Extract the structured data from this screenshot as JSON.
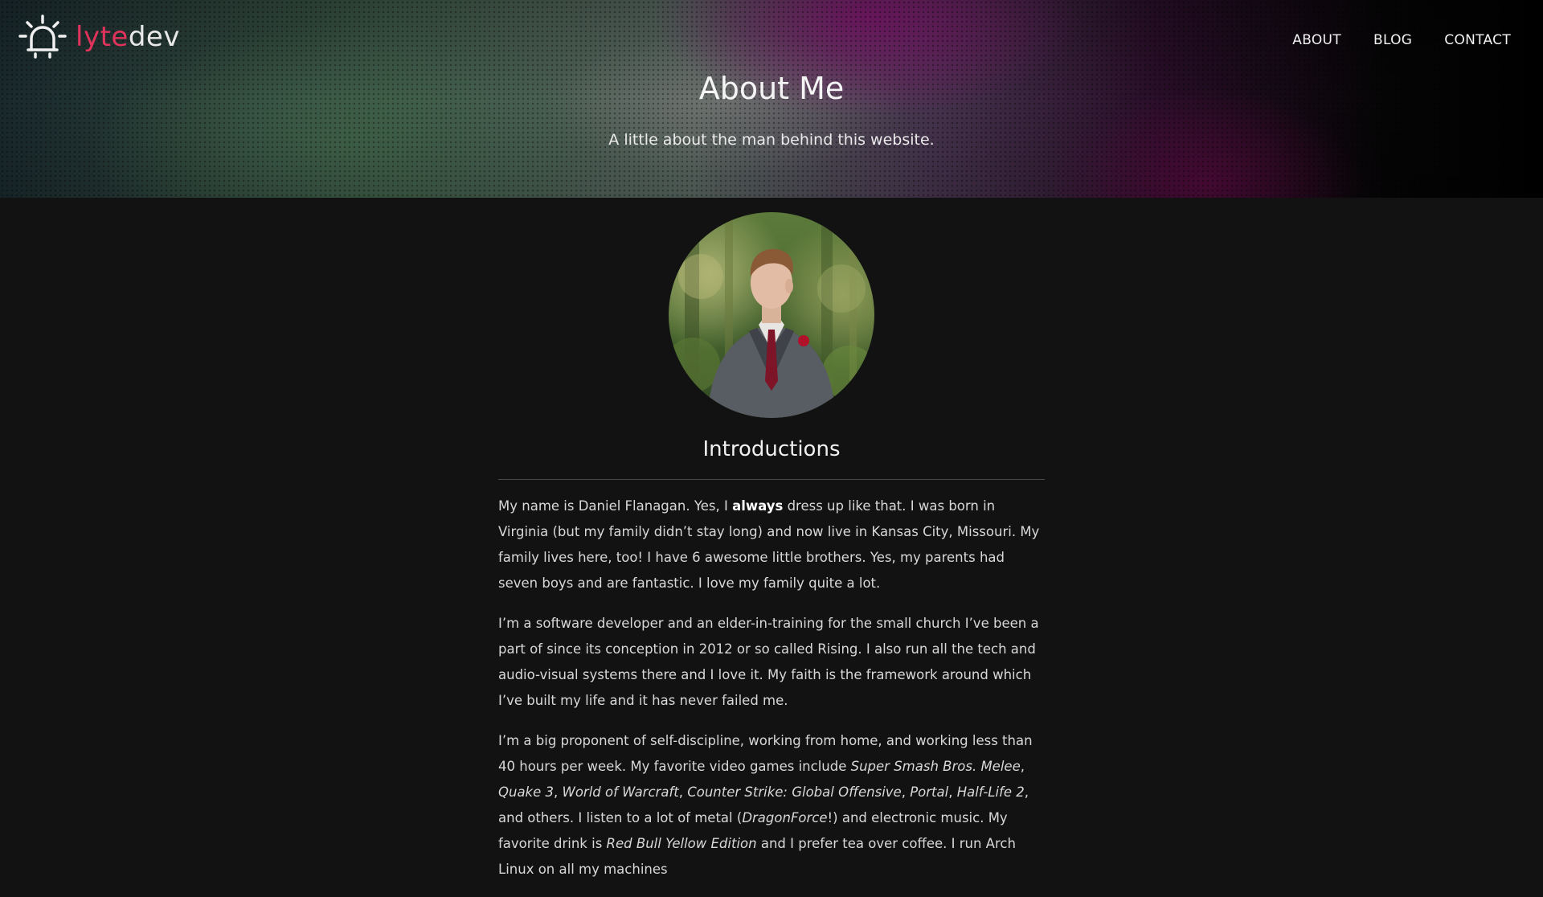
{
  "brand": {
    "logo_part1": "lyte",
    "logo_part2": "dev",
    "accent_color": "#e0335c"
  },
  "nav": {
    "items": [
      {
        "label": "ABOUT"
      },
      {
        "label": "BLOG"
      },
      {
        "label": "CONTACT"
      }
    ]
  },
  "hero": {
    "title": "About Me",
    "subtitle": "A little about the man behind this website."
  },
  "profile": {
    "avatar_icon": "portrait-photo"
  },
  "section": {
    "title": "Introductions",
    "paragraphs": [
      {
        "p1_a": "My name is Daniel Flanagan. Yes, I ",
        "p1_b": "always",
        "p1_c": " dress up like that. I was born in Virginia (but my family didn’t stay long) and now live in Kansas City, Missouri. My family lives here, too! I have 6 awesome little brothers. Yes, my parents had seven boys and are fantastic. I love my family quite a lot."
      },
      {
        "text": "I’m a software developer and an elder-in-training for the small church I’ve been a part of since its conception in 2012 or so called Rising. I also run all the tech and audio-visual systems there and I love it. My faith is the framework around which I’ve built my life and it has never failed me."
      },
      {
        "a": "I’m a big proponent of self-discipline, working from home, and working less than 40 hours per week. My favorite video games include ",
        "b": "Super Smash Bros. Melee",
        "c": ", ",
        "d": "Quake 3",
        "e": ", ",
        "f": "World of Warcraft",
        "g": ", ",
        "h": "Counter Strike: Global Offensive",
        "i": ", ",
        "j": "Portal",
        "k": ", ",
        "l": "Half-Life 2",
        "m": ", and others. I listen to a lot of metal (",
        "n": "DragonForce",
        "o": "!) and electronic music. My favorite drink is ",
        "p": "Red Bull Yellow Edition",
        "q": " and I prefer tea over coffee. I run Arch Linux on all my machines"
      }
    ]
  }
}
